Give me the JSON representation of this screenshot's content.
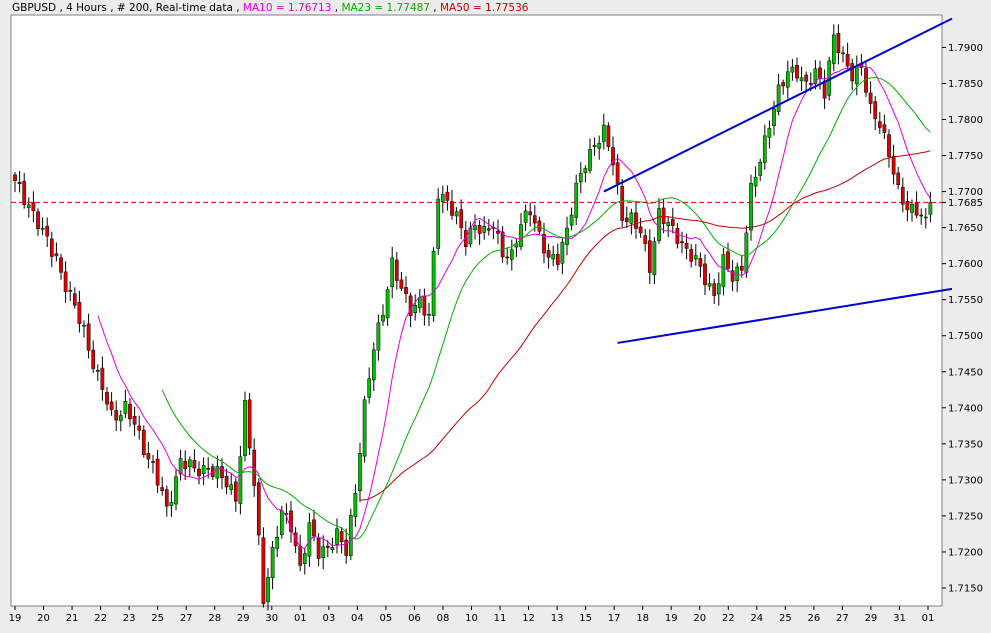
{
  "header": {
    "symbol_text": "GBPUSD , 4 Hours , # 200, Real-time data",
    "ma10_text": "MA10 = 1.76713",
    "ma23_text": "MA23 = 1.77487",
    "ma50_text": "MA50 = 1.77536",
    "separator": " , "
  },
  "colors": {
    "background": "#FFFFFF",
    "frame": "#ECECEC",
    "bull_candle": "#00C000",
    "bear_candle": "#E00000",
    "ma10": "#E000E0",
    "ma23": "#00B000",
    "ma50": "#C00000",
    "trendline": "#0000D0",
    "price_line": "#E00000"
  },
  "chart_data": {
    "type": "candlestick",
    "title": "GBPUSD , 4 Hours , # 200, Real-time data",
    "xlabel": "",
    "ylabel": "",
    "ylim": [
      1.7125,
      1.7945
    ],
    "grid": false,
    "y_ticks": [
      "1.7150",
      "1.7200",
      "1.7250",
      "1.7300",
      "1.7350",
      "1.7400",
      "1.7450",
      "1.7500",
      "1.7550",
      "1.7600",
      "1.7650",
      "1.7685",
      "1.7700",
      "1.7750",
      "1.7800",
      "1.7850",
      "1.7900"
    ],
    "x_tick_labels": [
      "19",
      "20",
      "21",
      "22",
      "23",
      "25",
      "27",
      "28",
      "29",
      "30",
      "01",
      "03",
      "04",
      "05",
      "06",
      "08",
      "10",
      "11",
      "12",
      "13",
      "15",
      "17",
      "18",
      "19",
      "20",
      "22",
      "24",
      "25",
      "26",
      "27",
      "29",
      "31",
      "01"
    ],
    "current_price": 1.7685,
    "close_path": [
      [
        0,
        1.771
      ],
      [
        3,
        1.7685
      ],
      [
        6,
        1.764
      ],
      [
        9,
        1.761
      ],
      [
        12,
        1.755
      ],
      [
        15,
        1.751
      ],
      [
        18,
        1.744
      ],
      [
        21,
        1.739
      ],
      [
        24,
        1.74
      ],
      [
        27,
        1.736
      ],
      [
        30,
        1.732
      ],
      [
        33,
        1.7255
      ],
      [
        36,
        1.733
      ],
      [
        39,
        1.731
      ],
      [
        42,
        1.732
      ],
      [
        45,
        1.73
      ],
      [
        48,
        1.728
      ],
      [
        50,
        1.74
      ],
      [
        52,
        1.729
      ],
      [
        54,
        1.714
      ],
      [
        56,
        1.72
      ],
      [
        58,
        1.725
      ],
      [
        60,
        1.724
      ],
      [
        62,
        1.718
      ],
      [
        64,
        1.723
      ],
      [
        66,
        1.72
      ],
      [
        68,
        1.721
      ],
      [
        70,
        1.722
      ],
      [
        72,
        1.72
      ],
      [
        74,
        1.729
      ],
      [
        76,
        1.74
      ],
      [
        78,
        1.748
      ],
      [
        80,
        1.754
      ],
      [
        82,
        1.76
      ],
      [
        84,
        1.756
      ],
      [
        86,
        1.754
      ],
      [
        88,
        1.755
      ],
      [
        90,
        1.752
      ],
      [
        92,
        1.77
      ],
      [
        94,
        1.769
      ],
      [
        96,
        1.766
      ],
      [
        98,
        1.763
      ],
      [
        100,
        1.766
      ],
      [
        102,
        1.764
      ],
      [
        104,
        1.765
      ],
      [
        106,
        1.762
      ],
      [
        108,
        1.761
      ],
      [
        110,
        1.765
      ],
      [
        112,
        1.768
      ],
      [
        114,
        1.764
      ],
      [
        116,
        1.76
      ],
      [
        118,
        1.761
      ],
      [
        120,
        1.765
      ],
      [
        122,
        1.77
      ],
      [
        124,
        1.774
      ],
      [
        126,
        1.777
      ],
      [
        128,
        1.778
      ],
      [
        130,
        1.774
      ],
      [
        132,
        1.767
      ],
      [
        134,
        1.766
      ],
      [
        136,
        1.764
      ],
      [
        138,
        1.76
      ],
      [
        140,
        1.767
      ],
      [
        142,
        1.765
      ],
      [
        144,
        1.764
      ],
      [
        146,
        1.762
      ],
      [
        148,
        1.76
      ],
      [
        150,
        1.758
      ],
      [
        152,
        1.756
      ],
      [
        154,
        1.76
      ],
      [
        156,
        1.758
      ],
      [
        158,
        1.76
      ],
      [
        160,
        1.77
      ],
      [
        162,
        1.774
      ],
      [
        164,
        1.78
      ],
      [
        166,
        1.784
      ],
      [
        168,
        1.786
      ],
      [
        170,
        1.787
      ],
      [
        172,
        1.785
      ],
      [
        174,
        1.786
      ],
      [
        176,
        1.784
      ],
      [
        178,
        1.792
      ],
      [
        180,
        1.788
      ],
      [
        182,
        1.786
      ],
      [
        184,
        1.788
      ],
      [
        186,
        1.781
      ],
      [
        188,
        1.779
      ],
      [
        190,
        1.776
      ],
      [
        192,
        1.77
      ],
      [
        194,
        1.767
      ],
      [
        196,
        1.768
      ],
      [
        198,
        1.766
      ],
      [
        199,
        1.7685
      ]
    ],
    "ma10_start": 18,
    "ma23_start": 32,
    "ma50_start": 75,
    "trendlines": [
      {
        "name": "upper",
        "from": [
          128,
          1.77
        ],
        "to": [
          288,
          1.794
        ]
      },
      {
        "name": "lower",
        "from": [
          131,
          1.749
        ],
        "to": [
          320,
          1.7565
        ]
      }
    ]
  }
}
